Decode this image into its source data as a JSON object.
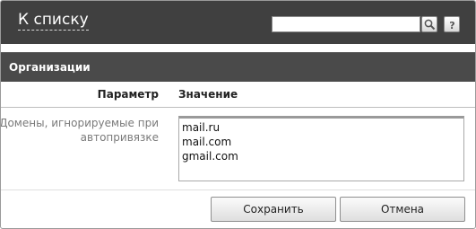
{
  "header": {
    "back_label": "К списку",
    "search": {
      "value": "",
      "placeholder": ""
    },
    "search_icon": "search-icon",
    "help_icon": "help-icon"
  },
  "section": {
    "title": "Организации"
  },
  "table": {
    "columns": [
      "Параметр",
      "Значение"
    ],
    "rows": [
      {
        "label": "Домены, игнорируемые при автопривязке",
        "value": "mail.ru\nmail.com\ngmail.com"
      }
    ]
  },
  "actions": {
    "save_label": "Сохранить",
    "cancel_label": "Отмена"
  }
}
